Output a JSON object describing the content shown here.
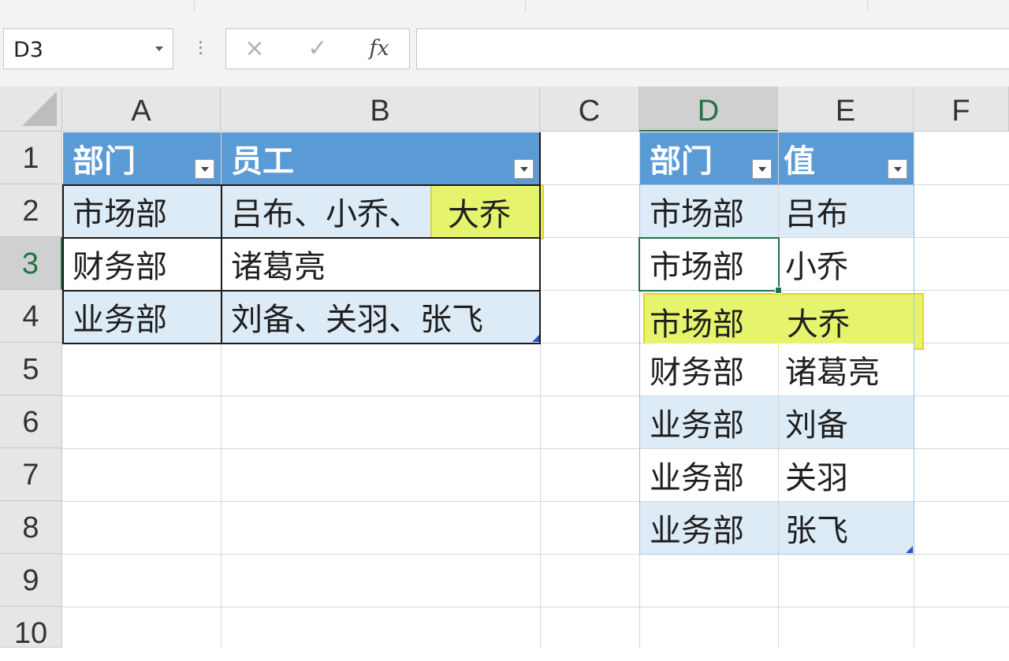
{
  "ribbon": {},
  "formula_bar": {
    "name_box": "D3",
    "cancel_icon": "×",
    "enter_icon": "✓",
    "fx_label": "fx",
    "formula_value": ""
  },
  "columns": [
    "A",
    "B",
    "C",
    "D",
    "E",
    "F"
  ],
  "rows": [
    "1",
    "2",
    "3",
    "4",
    "5",
    "6",
    "7",
    "8",
    "9",
    "10"
  ],
  "left_table": {
    "headers": [
      "部门",
      "员工"
    ],
    "rows": [
      {
        "dept": "市场部",
        "staff": "吕布、小乔、",
        "staff_highlight": "大乔"
      },
      {
        "dept": "财务部",
        "staff": "诸葛亮",
        "staff_highlight": ""
      },
      {
        "dept": "业务部",
        "staff": "刘备、关羽、张飞",
        "staff_highlight": ""
      }
    ]
  },
  "right_table": {
    "headers": [
      "部门",
      "值"
    ],
    "rows": [
      {
        "dept": "市场部",
        "value": "吕布"
      },
      {
        "dept": "市场部",
        "value": "小乔"
      },
      {
        "dept": "市场部",
        "value": "大乔"
      },
      {
        "dept": "财务部",
        "value": "诸葛亮"
      },
      {
        "dept": "业务部",
        "value": "刘备"
      },
      {
        "dept": "业务部",
        "value": "关羽"
      },
      {
        "dept": "业务部",
        "value": "张飞"
      }
    ]
  },
  "colors": {
    "table_header": "#5b9bd5",
    "table_band": "#ddebf7",
    "highlight": "#e6f36c",
    "selection": "#217346"
  },
  "icons": [
    "dropdown-arrow-icon",
    "cancel-icon",
    "enter-icon",
    "function-icon",
    "filter-dropdown-icon",
    "select-all-icon"
  ]
}
